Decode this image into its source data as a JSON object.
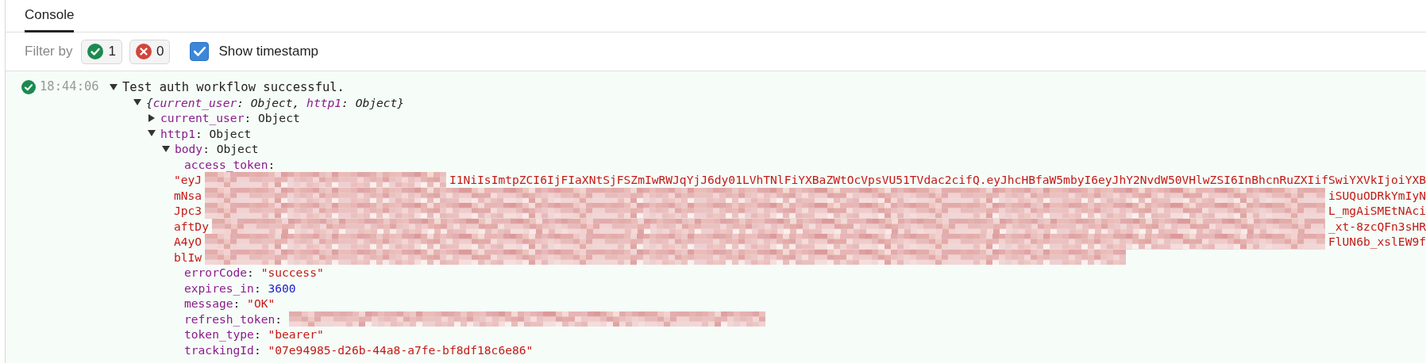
{
  "tabs": [
    {
      "label": "Console",
      "selected": true
    }
  ],
  "filter": {
    "label": "Filter by",
    "chips": [
      {
        "kind": "success",
        "count": "1",
        "selected": false
      },
      {
        "kind": "error",
        "count": "0",
        "selected": false
      }
    ],
    "timestamp_toggle": {
      "label": "Show timestamp",
      "checked": true
    }
  },
  "log": {
    "kind": "success",
    "timestamp": "18:44:06",
    "message": "Test auth workflow successful.",
    "expanded": true,
    "children": [
      {
        "kind": "summary",
        "expanded": true,
        "parts": [
          {
            "kind": "punct",
            "text": "{"
          },
          {
            "kind": "key",
            "text": "current_user"
          },
          {
            "kind": "punct",
            "text": ": "
          },
          {
            "kind": "value",
            "text": "Object"
          },
          {
            "kind": "punct",
            "text": ", "
          },
          {
            "kind": "key",
            "text": "http1"
          },
          {
            "kind": "punct",
            "text": ": "
          },
          {
            "kind": "value",
            "text": "Object"
          },
          {
            "kind": "punct",
            "text": "}"
          }
        ],
        "children": [
          {
            "kind": "object",
            "expanded": false,
            "parts": [
              {
                "kind": "key",
                "text": "current_user"
              },
              {
                "kind": "punct",
                "text": ": "
              },
              {
                "kind": "value",
                "text": "Object"
              }
            ]
          },
          {
            "kind": "object",
            "expanded": true,
            "parts": [
              {
                "kind": "key",
                "text": "http1"
              },
              {
                "kind": "punct",
                "text": ": "
              },
              {
                "kind": "value",
                "text": "Object"
              }
            ],
            "children": [
              {
                "kind": "object",
                "expanded": true,
                "parts": [
                  {
                    "kind": "key",
                    "text": "body"
                  },
                  {
                    "kind": "punct",
                    "text": ": "
                  },
                  {
                    "kind": "value",
                    "text": "Object"
                  }
                ],
                "children": [
                  {
                    "kind": "token",
                    "parts": [
                      {
                        "kind": "key",
                        "text": "access_token"
                      },
                      {
                        "kind": "punct",
                        "text": ":"
                      }
                    ],
                    "lines": [
                      [
                        {
                          "kind": "text",
                          "text": "\"eyJ"
                        },
                        {
                          "kind": "redacted"
                        },
                        {
                          "kind": "text",
                          "text": "I1NiIsImtpZCI6IjFIaXNtSjFSZmIwRWJqYjJ6dy01LVhTNlFiYXBaZWtOcVpsVU51TVdac2cifQ.eyJhcHBfaW5mbyI6eyJhY2NvdW50VHlwZSI6InBhcnRuZXIifSwiYXVkIjoiYXB"
                        }
                      ],
                      [
                        {
                          "kind": "text",
                          "text": "mNsa"
                        },
                        {
                          "kind": "redacted"
                        },
                        {
                          "kind": "text",
                          "text": "iSUQuODRkYmIyN"
                        }
                      ],
                      [
                        {
                          "kind": "text",
                          "text": "Jpc3"
                        },
                        {
                          "kind": "redacted"
                        },
                        {
                          "kind": "text",
                          "text": "L_mgAiSMEtNAci"
                        }
                      ],
                      [
                        {
                          "kind": "text",
                          "text": "aftDy"
                        },
                        {
                          "kind": "redacted"
                        },
                        {
                          "kind": "text",
                          "text": "_xt-8zcQFn3sHR"
                        }
                      ],
                      [
                        {
                          "kind": "text",
                          "text": "A4yO"
                        },
                        {
                          "kind": "redacted"
                        },
                        {
                          "kind": "text",
                          "text": "FlUN6b_xslEW9f"
                        }
                      ],
                      [
                        {
                          "kind": "text",
                          "text": "blIw"
                        },
                        {
                          "kind": "redacted"
                        }
                      ]
                    ]
                  },
                  {
                    "kind": "leaf",
                    "parts": [
                      {
                        "kind": "key",
                        "text": "errorCode"
                      },
                      {
                        "kind": "punct",
                        "text": ": "
                      },
                      {
                        "kind": "string",
                        "text": "\"success\""
                      }
                    ]
                  },
                  {
                    "kind": "leaf",
                    "parts": [
                      {
                        "kind": "key",
                        "text": "expires_in"
                      },
                      {
                        "kind": "punct",
                        "text": ": "
                      },
                      {
                        "kind": "number",
                        "text": "3600"
                      }
                    ]
                  },
                  {
                    "kind": "leaf",
                    "parts": [
                      {
                        "kind": "key",
                        "text": "message"
                      },
                      {
                        "kind": "punct",
                        "text": ": "
                      },
                      {
                        "kind": "string",
                        "text": "\"OK\""
                      }
                    ]
                  },
                  {
                    "kind": "redacted",
                    "parts": [
                      {
                        "kind": "key",
                        "text": "refresh_token"
                      },
                      {
                        "kind": "punct",
                        "text": ":"
                      }
                    ]
                  },
                  {
                    "kind": "leaf",
                    "parts": [
                      {
                        "kind": "key",
                        "text": "token_type"
                      },
                      {
                        "kind": "punct",
                        "text": ": "
                      },
                      {
                        "kind": "string",
                        "text": "\"bearer\""
                      }
                    ]
                  },
                  {
                    "kind": "leaf",
                    "parts": [
                      {
                        "kind": "key",
                        "text": "trackingId"
                      },
                      {
                        "kind": "punct",
                        "text": ": "
                      },
                      {
                        "kind": "string",
                        "text": "\"07e94985-d26b-44a8-a7fe-bf8df18c6e86\""
                      }
                    ]
                  }
                ]
              }
            ]
          }
        ]
      }
    ]
  }
}
